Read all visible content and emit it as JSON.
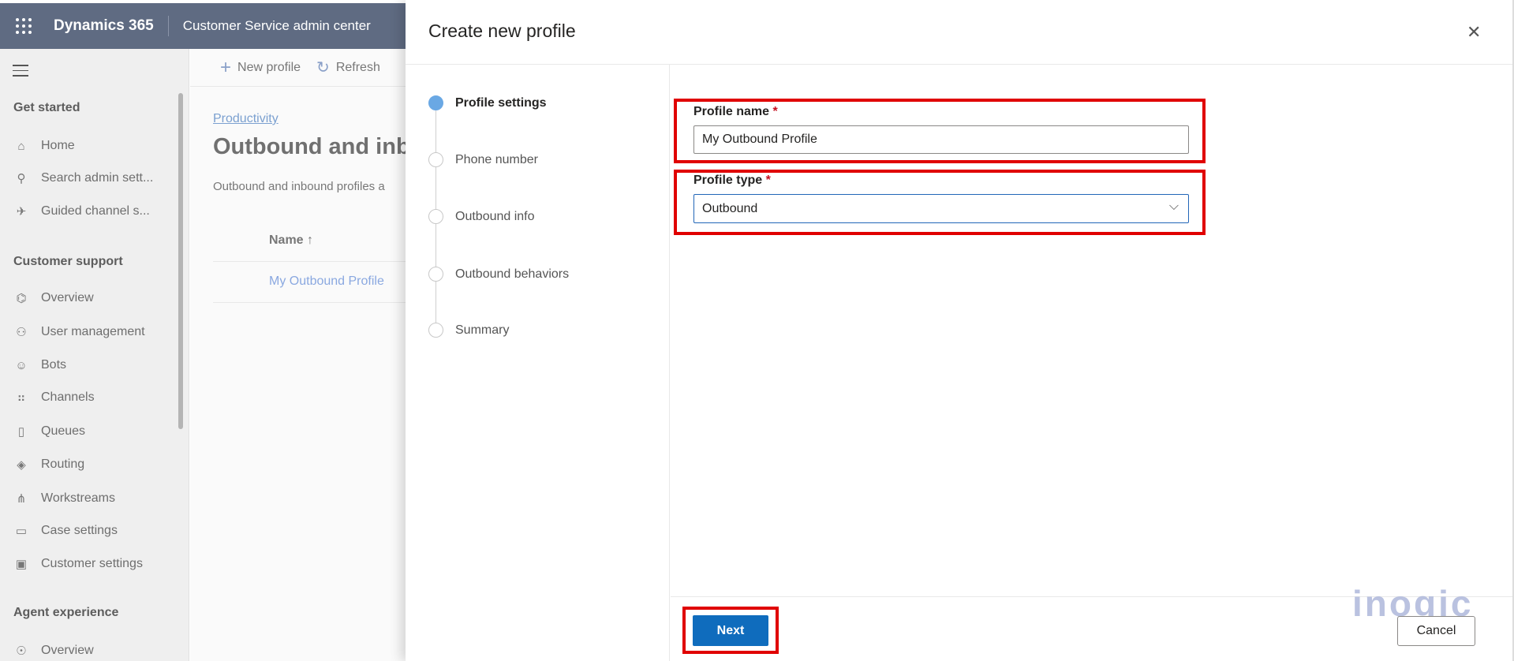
{
  "header": {
    "brand": "Dynamics 365",
    "app": "Customer Service admin center"
  },
  "sidebar": {
    "sections": [
      {
        "title": "Get started",
        "items": [
          {
            "label": "Home",
            "icon": "home-icon"
          },
          {
            "label": "Search admin sett...",
            "icon": "search-icon"
          },
          {
            "label": "Guided channel s...",
            "icon": "rocket-icon"
          }
        ]
      },
      {
        "title": "Customer support",
        "items": [
          {
            "label": "Overview",
            "icon": "overview-icon"
          },
          {
            "label": "User management",
            "icon": "users-icon"
          },
          {
            "label": "Bots",
            "icon": "bot-icon"
          },
          {
            "label": "Channels",
            "icon": "channels-icon"
          },
          {
            "label": "Queues",
            "icon": "queue-icon"
          },
          {
            "label": "Routing",
            "icon": "routing-icon"
          },
          {
            "label": "Workstreams",
            "icon": "workstream-icon"
          },
          {
            "label": "Case settings",
            "icon": "case-icon"
          },
          {
            "label": "Customer settings",
            "icon": "customer-icon"
          }
        ]
      },
      {
        "title": "Agent experience",
        "items": [
          {
            "label": "Overview",
            "icon": "person-icon"
          }
        ]
      }
    ]
  },
  "main": {
    "toolbar": {
      "new": "New profile",
      "refresh": "Refresh"
    },
    "breadcrumb": "Productivity",
    "title": "Outbound and inbound profiles",
    "description": "Outbound and inbound profiles a",
    "column": "Name ↑",
    "rows": [
      "My Outbound Profile"
    ]
  },
  "panel": {
    "title": "Create new profile",
    "steps": [
      "Profile settings",
      "Phone number",
      "Outbound info",
      "Outbound behaviors",
      "Summary"
    ],
    "active_step": 0,
    "profile_name_label": "Profile name",
    "profile_name_value": "My Outbound Profile",
    "profile_type_label": "Profile type",
    "profile_type_value": "Outbound",
    "required": "*",
    "next": "Next",
    "cancel": "Cancel"
  },
  "watermark": "inogic",
  "colors": {
    "header": "#5f6b82",
    "primary": "#0f6cbd",
    "highlight": "#e00000"
  }
}
